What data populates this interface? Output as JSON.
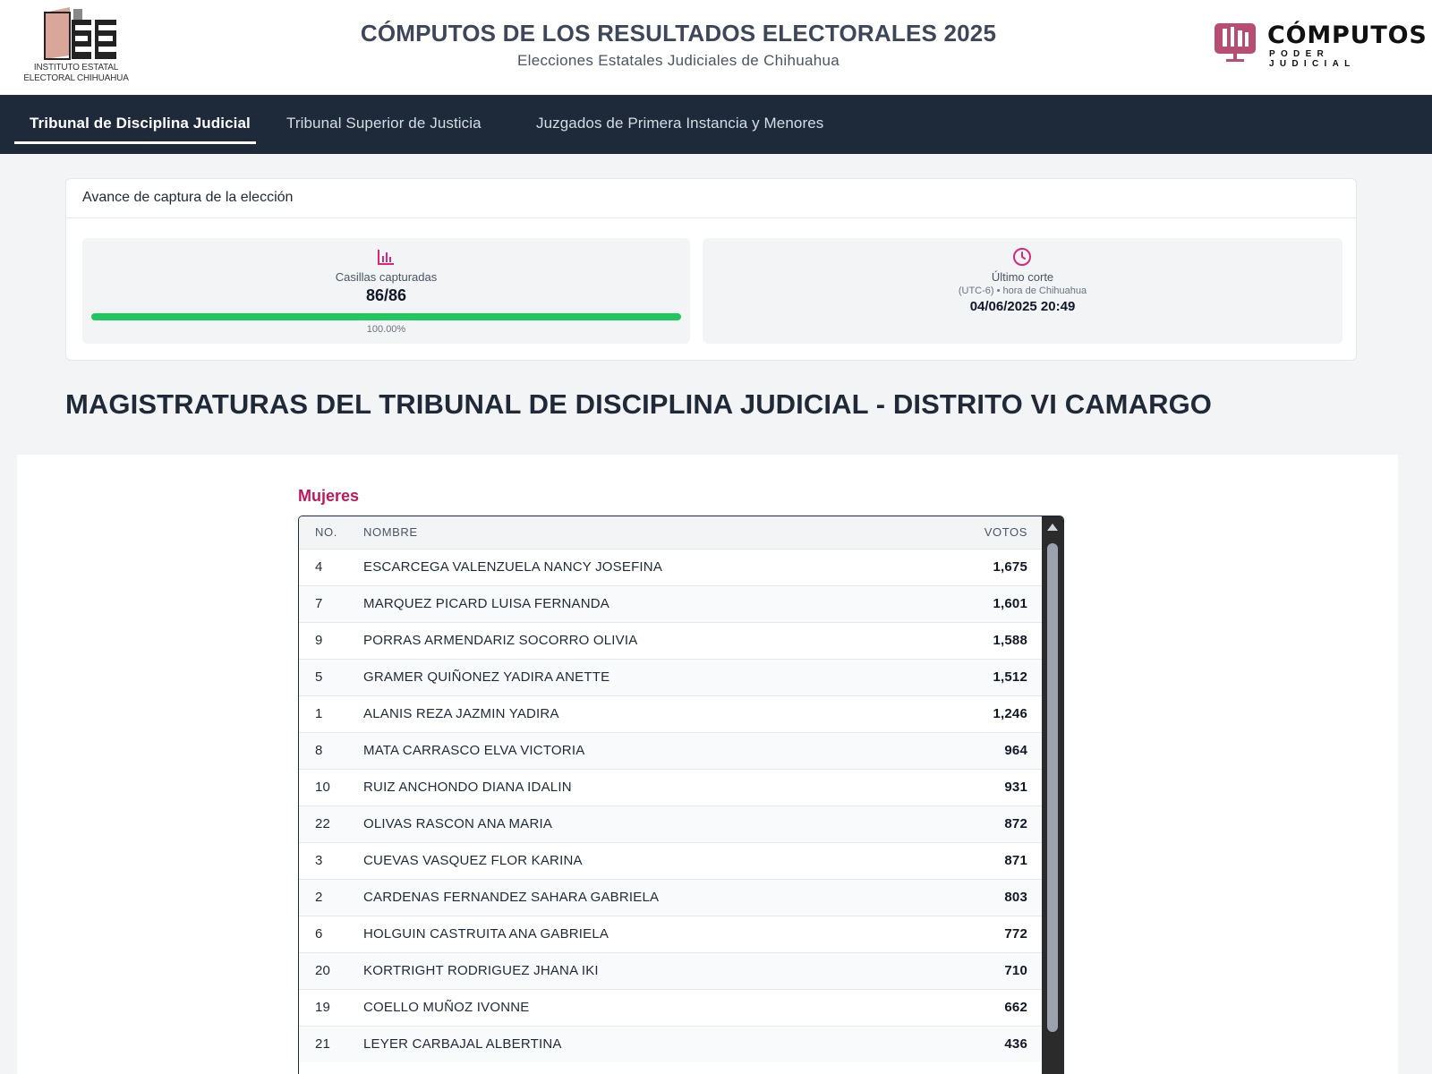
{
  "header": {
    "iee_logo_text": "INSTITUTO ESTATAL ELECTORAL CHIHUAHUA",
    "title": "CÓMPUTOS DE LOS RESULTADOS ELECTORALES 2025",
    "subtitle": "Elecciones Estatales Judiciales de Chihuahua",
    "brand_title": "CÓMPUTOS",
    "brand_subtitle": "PODER JUDICIAL"
  },
  "nav": {
    "tabs": [
      {
        "label": "Tribunal de Disciplina Judicial",
        "active": true
      },
      {
        "label": "Tribunal Superior de Justicia",
        "active": false
      },
      {
        "label": "Juzgados de Primera Instancia y Menores",
        "active": false
      }
    ]
  },
  "progress": {
    "title": "Avance de captura de la elección",
    "casillas_label": "Casillas capturadas",
    "casillas_value": "86/86",
    "fraction": 1.0,
    "percent_text": "100.00%",
    "cutoff_label": "Último corte",
    "cutoff_tz": "(UTC-6) • hora de Chihuahua",
    "cutoff_value": "04/06/2025 20:49"
  },
  "section_title": "MAGISTRATURAS DEL TRIBUNAL DE DISCIPLINA JUDICIAL - DISTRITO VI CAMARGO",
  "results": {
    "group_label": "Mujeres",
    "columns": {
      "no": "NO.",
      "name": "NOMBRE",
      "votes": "VOTOS"
    },
    "rows": [
      {
        "no": "4",
        "name": "ESCARCEGA VALENZUELA NANCY JOSEFINA",
        "votes": "1,675"
      },
      {
        "no": "7",
        "name": "MARQUEZ PICARD LUISA FERNANDA",
        "votes": "1,601"
      },
      {
        "no": "9",
        "name": "PORRAS ARMENDARIZ SOCORRO OLIVIA",
        "votes": "1,588"
      },
      {
        "no": "5",
        "name": "GRAMER QUIÑONEZ YADIRA ANETTE",
        "votes": "1,512"
      },
      {
        "no": "1",
        "name": "ALANIS REZA JAZMIN YADIRA",
        "votes": "1,246"
      },
      {
        "no": "8",
        "name": "MATA CARRASCO ELVA VICTORIA",
        "votes": "964"
      },
      {
        "no": "10",
        "name": "RUIZ ANCHONDO DIANA IDALIN",
        "votes": "931"
      },
      {
        "no": "22",
        "name": "OLIVAS RASCON ANA MARIA",
        "votes": "872"
      },
      {
        "no": "3",
        "name": "CUEVAS VASQUEZ FLOR KARINA",
        "votes": "871"
      },
      {
        "no": "2",
        "name": "CARDENAS FERNANDEZ SAHARA GABRIELA",
        "votes": "803"
      },
      {
        "no": "6",
        "name": "HOLGUIN CASTRUITA ANA GABRIELA",
        "votes": "772"
      },
      {
        "no": "20",
        "name": "KORTRIGHT RODRIGUEZ JHANA IKI",
        "votes": "710"
      },
      {
        "no": "19",
        "name": "COELLO MUÑOZ IVONNE",
        "votes": "662"
      },
      {
        "no": "21",
        "name": "LEYER CARBAJAL ALBERTINA",
        "votes": "436"
      }
    ]
  },
  "colors": {
    "nav_bg": "#1e2a3a",
    "accent_pink": "#be185d",
    "progress_green": "#22c55e",
    "brand_icon": "#b84d73"
  },
  "icons": {
    "casillas": "bar-chart-icon",
    "cutoff": "clock-icon",
    "scroll_up": "scroll-up-arrow-icon"
  }
}
